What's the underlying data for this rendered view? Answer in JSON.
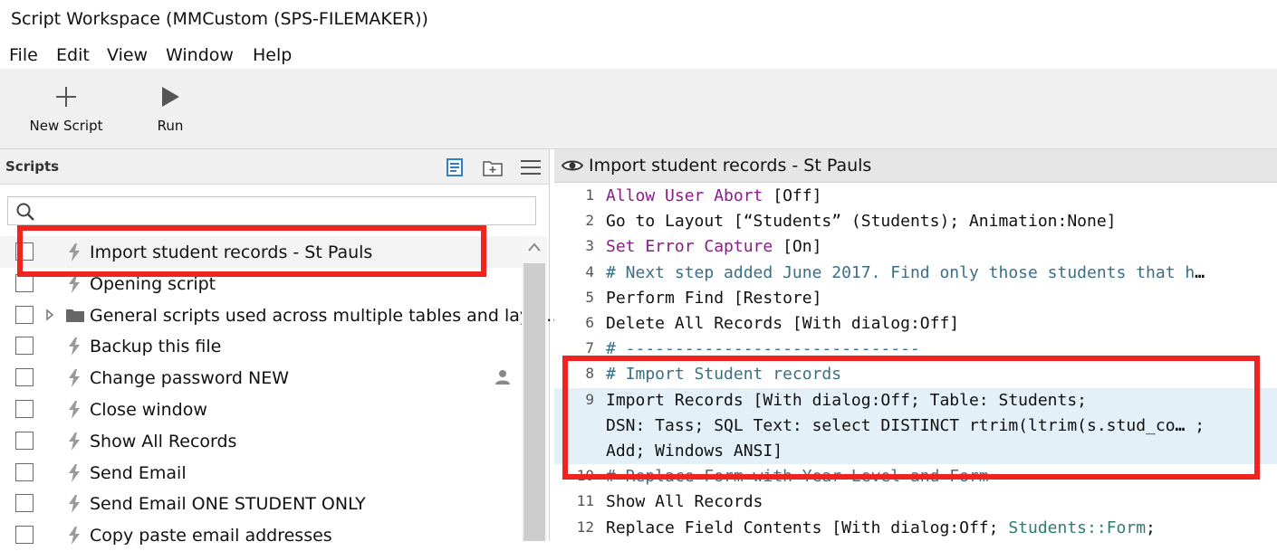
{
  "window": {
    "title": "Script Workspace (MMCustom (SPS-FILEMAKER))"
  },
  "menu": [
    "File",
    "Edit",
    "View",
    "Window",
    "Help"
  ],
  "toolbar": {
    "new_script": "New Script",
    "run": "Run"
  },
  "scripts_panel": {
    "title": "Scripts",
    "search_placeholder": "",
    "items": [
      {
        "label": "Import student records - St Pauls",
        "icon": "script-icon"
      },
      {
        "label": "Opening script",
        "icon": "script-icon"
      },
      {
        "label": "General scripts used across multiple tables and layo…",
        "icon": "folder-icon"
      },
      {
        "label": "Backup this file",
        "icon": "script-icon"
      },
      {
        "label": "Change password NEW",
        "icon": "script-icon"
      },
      {
        "label": "Close window",
        "icon": "script-icon"
      },
      {
        "label": "Show All Records",
        "icon": "script-icon"
      },
      {
        "label": "Send Email",
        "icon": "script-icon"
      },
      {
        "label": "Send Email ONE STUDENT ONLY",
        "icon": "script-icon"
      },
      {
        "label": "Copy paste email addresses",
        "icon": "script-icon"
      }
    ]
  },
  "editor": {
    "title": "Import student records - St Pauls",
    "lines": [
      {
        "n": "1",
        "a": "Allow User Abort",
        "b": " [Off]"
      },
      {
        "n": "2",
        "a": "",
        "b": "Go to Layout [“Students” (Students); Animation:None]"
      },
      {
        "n": "3",
        "a": "Set Error Capture",
        "b": " [On]"
      },
      {
        "n": "4",
        "a": "",
        "b": "# Next step added June 2017. Find only those students that h"
      },
      {
        "n": "5",
        "a": "",
        "b": "Perform Find [Restore]"
      },
      {
        "n": "6",
        "a": "",
        "b": "Delete All Records [With dialog:Off]"
      },
      {
        "n": "7",
        "a": "",
        "b": "# ------------------------------"
      },
      {
        "n": "8",
        "a": "",
        "b": "# Import Student records"
      },
      {
        "n": "9",
        "a": "",
        "b": "Import Records [With dialog:Off; Table: Students;"
      },
      {
        "n": "",
        "a": "",
        "b": "DSN: Tass; SQL Text: select DISTINCT rtrim(ltrim(s.stud_co"
      },
      {
        "n": "",
        "a": "",
        "b": "Add; Windows ANSI]"
      },
      {
        "n": "10",
        "a": "",
        "b": "# Replace Form with Year Level and Form"
      },
      {
        "n": "11",
        "a": "",
        "b": "Show All Records"
      },
      {
        "n": "12",
        "a": "Replace Field Contents [With dialog:Off; ",
        "b": "Students::Form",
        "c": ";"
      }
    ],
    "trunc_marks": {
      "line4": "…",
      "line9b": "…",
      "line9b_tail": " ;"
    }
  }
}
